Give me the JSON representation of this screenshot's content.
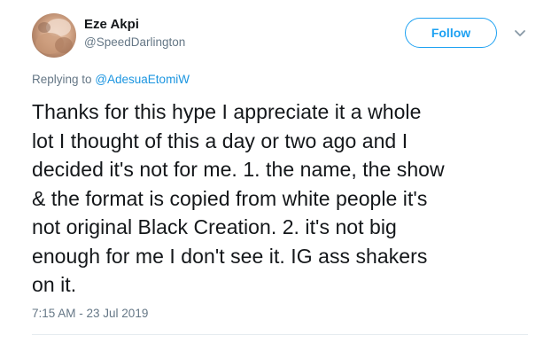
{
  "user": {
    "display_name": "Eze Akpi",
    "handle": "@SpeedDarlington"
  },
  "actions": {
    "follow_label": "Follow",
    "more_icon": "chevron-down-icon"
  },
  "reply": {
    "prefix": "Replying to",
    "mention": "@AdesuaEtomiW"
  },
  "tweet": {
    "text_lines": [
      "Thanks for this hype I appreciate it a whole",
      "lot I thought of this a day or two ago and I",
      "decided it's not for me. 1. the name, the show",
      "& the format is copied from white people it's",
      "not original Black Creation. 2. it's not big",
      "enough for me I don't see it. IG ass shakers",
      "on it."
    ],
    "timestamp": "7:15 AM - 23 Jul 2019"
  },
  "colors": {
    "accent": "#1da1f2",
    "link": "#1b95e0",
    "secondary_text": "#657786",
    "primary_text": "#14171a",
    "divider": "#e6ecf0"
  }
}
